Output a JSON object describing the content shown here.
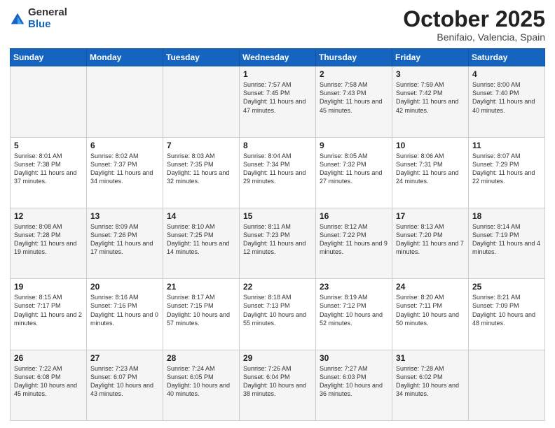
{
  "header": {
    "logo": {
      "line1": "General",
      "line2": "Blue"
    },
    "month": "October 2025",
    "location": "Benifaio, Valencia, Spain"
  },
  "weekdays": [
    "Sunday",
    "Monday",
    "Tuesday",
    "Wednesday",
    "Thursday",
    "Friday",
    "Saturday"
  ],
  "weeks": [
    [
      {
        "day": "",
        "info": ""
      },
      {
        "day": "",
        "info": ""
      },
      {
        "day": "",
        "info": ""
      },
      {
        "day": "1",
        "info": "Sunrise: 7:57 AM\nSunset: 7:45 PM\nDaylight: 11 hours\nand 47 minutes."
      },
      {
        "day": "2",
        "info": "Sunrise: 7:58 AM\nSunset: 7:43 PM\nDaylight: 11 hours\nand 45 minutes."
      },
      {
        "day": "3",
        "info": "Sunrise: 7:59 AM\nSunset: 7:42 PM\nDaylight: 11 hours\nand 42 minutes."
      },
      {
        "day": "4",
        "info": "Sunrise: 8:00 AM\nSunset: 7:40 PM\nDaylight: 11 hours\nand 40 minutes."
      }
    ],
    [
      {
        "day": "5",
        "info": "Sunrise: 8:01 AM\nSunset: 7:38 PM\nDaylight: 11 hours\nand 37 minutes."
      },
      {
        "day": "6",
        "info": "Sunrise: 8:02 AM\nSunset: 7:37 PM\nDaylight: 11 hours\nand 34 minutes."
      },
      {
        "day": "7",
        "info": "Sunrise: 8:03 AM\nSunset: 7:35 PM\nDaylight: 11 hours\nand 32 minutes."
      },
      {
        "day": "8",
        "info": "Sunrise: 8:04 AM\nSunset: 7:34 PM\nDaylight: 11 hours\nand 29 minutes."
      },
      {
        "day": "9",
        "info": "Sunrise: 8:05 AM\nSunset: 7:32 PM\nDaylight: 11 hours\nand 27 minutes."
      },
      {
        "day": "10",
        "info": "Sunrise: 8:06 AM\nSunset: 7:31 PM\nDaylight: 11 hours\nand 24 minutes."
      },
      {
        "day": "11",
        "info": "Sunrise: 8:07 AM\nSunset: 7:29 PM\nDaylight: 11 hours\nand 22 minutes."
      }
    ],
    [
      {
        "day": "12",
        "info": "Sunrise: 8:08 AM\nSunset: 7:28 PM\nDaylight: 11 hours\nand 19 minutes."
      },
      {
        "day": "13",
        "info": "Sunrise: 8:09 AM\nSunset: 7:26 PM\nDaylight: 11 hours\nand 17 minutes."
      },
      {
        "day": "14",
        "info": "Sunrise: 8:10 AM\nSunset: 7:25 PM\nDaylight: 11 hours\nand 14 minutes."
      },
      {
        "day": "15",
        "info": "Sunrise: 8:11 AM\nSunset: 7:23 PM\nDaylight: 11 hours\nand 12 minutes."
      },
      {
        "day": "16",
        "info": "Sunrise: 8:12 AM\nSunset: 7:22 PM\nDaylight: 11 hours\nand 9 minutes."
      },
      {
        "day": "17",
        "info": "Sunrise: 8:13 AM\nSunset: 7:20 PM\nDaylight: 11 hours\nand 7 minutes."
      },
      {
        "day": "18",
        "info": "Sunrise: 8:14 AM\nSunset: 7:19 PM\nDaylight: 11 hours\nand 4 minutes."
      }
    ],
    [
      {
        "day": "19",
        "info": "Sunrise: 8:15 AM\nSunset: 7:17 PM\nDaylight: 11 hours\nand 2 minutes."
      },
      {
        "day": "20",
        "info": "Sunrise: 8:16 AM\nSunset: 7:16 PM\nDaylight: 11 hours\nand 0 minutes."
      },
      {
        "day": "21",
        "info": "Sunrise: 8:17 AM\nSunset: 7:15 PM\nDaylight: 10 hours\nand 57 minutes."
      },
      {
        "day": "22",
        "info": "Sunrise: 8:18 AM\nSunset: 7:13 PM\nDaylight: 10 hours\nand 55 minutes."
      },
      {
        "day": "23",
        "info": "Sunrise: 8:19 AM\nSunset: 7:12 PM\nDaylight: 10 hours\nand 52 minutes."
      },
      {
        "day": "24",
        "info": "Sunrise: 8:20 AM\nSunset: 7:11 PM\nDaylight: 10 hours\nand 50 minutes."
      },
      {
        "day": "25",
        "info": "Sunrise: 8:21 AM\nSunset: 7:09 PM\nDaylight: 10 hours\nand 48 minutes."
      }
    ],
    [
      {
        "day": "26",
        "info": "Sunrise: 7:22 AM\nSunset: 6:08 PM\nDaylight: 10 hours\nand 45 minutes."
      },
      {
        "day": "27",
        "info": "Sunrise: 7:23 AM\nSunset: 6:07 PM\nDaylight: 10 hours\nand 43 minutes."
      },
      {
        "day": "28",
        "info": "Sunrise: 7:24 AM\nSunset: 6:05 PM\nDaylight: 10 hours\nand 40 minutes."
      },
      {
        "day": "29",
        "info": "Sunrise: 7:26 AM\nSunset: 6:04 PM\nDaylight: 10 hours\nand 38 minutes."
      },
      {
        "day": "30",
        "info": "Sunrise: 7:27 AM\nSunset: 6:03 PM\nDaylight: 10 hours\nand 36 minutes."
      },
      {
        "day": "31",
        "info": "Sunrise: 7:28 AM\nSunset: 6:02 PM\nDaylight: 10 hours\nand 34 minutes."
      },
      {
        "day": "",
        "info": ""
      }
    ]
  ]
}
